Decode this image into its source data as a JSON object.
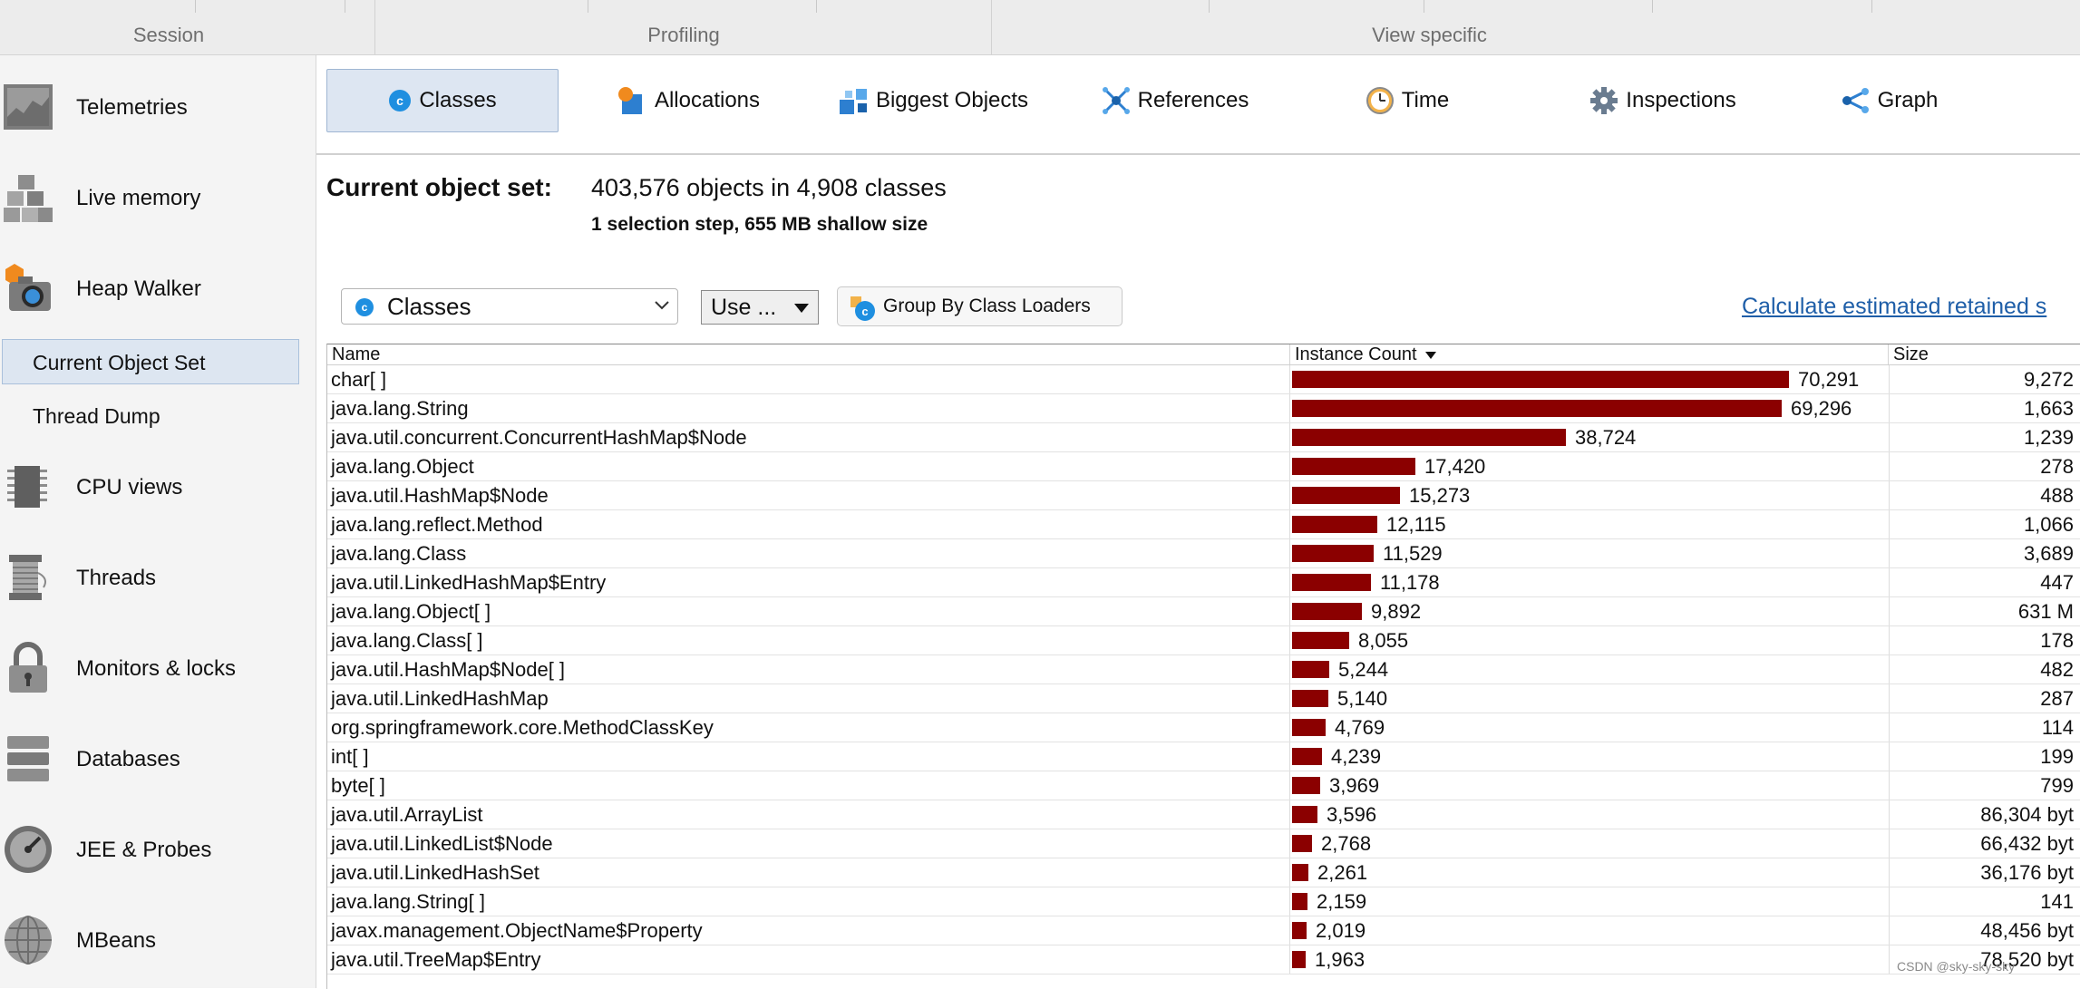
{
  "ribbon": {
    "groups": [
      {
        "label": "Session"
      },
      {
        "label": "Profiling"
      },
      {
        "label": "View specific"
      }
    ]
  },
  "sidebar": {
    "items": [
      {
        "label": "Telemetries",
        "icon": "telemetries-icon"
      },
      {
        "label": "Live memory",
        "icon": "live-memory-icon"
      },
      {
        "label": "Heap Walker",
        "icon": "heap-walker-icon"
      },
      {
        "label": "CPU views",
        "icon": "cpu-views-icon"
      },
      {
        "label": "Threads",
        "icon": "threads-icon"
      },
      {
        "label": "Monitors & locks",
        "icon": "monitors-locks-icon"
      },
      {
        "label": "Databases",
        "icon": "databases-icon"
      },
      {
        "label": "JEE & Probes",
        "icon": "jee-probes-icon"
      },
      {
        "label": "MBeans",
        "icon": "mbeans-icon"
      }
    ],
    "sub_items": [
      {
        "label": "Current Object Set",
        "selected": true
      },
      {
        "label": "Thread Dump",
        "selected": false
      }
    ]
  },
  "tabs": [
    {
      "label": "Classes",
      "icon": "classes-icon",
      "selected": true
    },
    {
      "label": "Allocations",
      "icon": "allocations-icon",
      "selected": false
    },
    {
      "label": "Biggest Objects",
      "icon": "biggest-objects-icon",
      "selected": false
    },
    {
      "label": "References",
      "icon": "references-icon",
      "selected": false
    },
    {
      "label": "Time",
      "icon": "time-icon",
      "selected": false
    },
    {
      "label": "Inspections",
      "icon": "inspections-icon",
      "selected": false
    },
    {
      "label": "Graph",
      "icon": "graph-icon",
      "selected": false
    }
  ],
  "object_set": {
    "title": "Current object set:",
    "summary": "403,576 objects in 4,908 classes",
    "sub": "1 selection step, 655 MB shallow size"
  },
  "toolbar": {
    "view_select": "Classes",
    "use_button": "Use ...",
    "group_button": "Group By Class Loaders",
    "calc_link": "Calculate estimated retained s"
  },
  "table": {
    "columns": {
      "name": "Name",
      "count": "Instance Count",
      "size": "Size"
    },
    "max_count": 70291,
    "bar_color": "#8b0000",
    "rows": [
      {
        "name": "char[ ]",
        "count": "70,291",
        "value": 70291,
        "size": "9,272"
      },
      {
        "name": "java.lang.String",
        "count": "69,296",
        "value": 69296,
        "size": "1,663"
      },
      {
        "name": "java.util.concurrent.ConcurrentHashMap$Node",
        "count": "38,724",
        "value": 38724,
        "size": "1,239"
      },
      {
        "name": "java.lang.Object",
        "count": "17,420",
        "value": 17420,
        "size": "278"
      },
      {
        "name": "java.util.HashMap$Node",
        "count": "15,273",
        "value": 15273,
        "size": "488"
      },
      {
        "name": "java.lang.reflect.Method",
        "count": "12,115",
        "value": 12115,
        "size": "1,066"
      },
      {
        "name": "java.lang.Class",
        "count": "11,529",
        "value": 11529,
        "size": "3,689"
      },
      {
        "name": "java.util.LinkedHashMap$Entry",
        "count": "11,178",
        "value": 11178,
        "size": "447"
      },
      {
        "name": "java.lang.Object[ ]",
        "count": "9,892",
        "value": 9892,
        "size": "631 M"
      },
      {
        "name": "java.lang.Class[ ]",
        "count": "8,055",
        "value": 8055,
        "size": "178"
      },
      {
        "name": "java.util.HashMap$Node[ ]",
        "count": "5,244",
        "value": 5244,
        "size": "482"
      },
      {
        "name": "java.util.LinkedHashMap",
        "count": "5,140",
        "value": 5140,
        "size": "287"
      },
      {
        "name": "org.springframework.core.MethodClassKey",
        "count": "4,769",
        "value": 4769,
        "size": "114"
      },
      {
        "name": "int[ ]",
        "count": "4,239",
        "value": 4239,
        "size": "199"
      },
      {
        "name": "byte[ ]",
        "count": "3,969",
        "value": 3969,
        "size": "799"
      },
      {
        "name": "java.util.ArrayList",
        "count": "3,596",
        "value": 3596,
        "size": "86,304 byt"
      },
      {
        "name": "java.util.LinkedList$Node",
        "count": "2,768",
        "value": 2768,
        "size": "66,432 byt"
      },
      {
        "name": "java.util.LinkedHashSet",
        "count": "2,261",
        "value": 2261,
        "size": "36,176 byt"
      },
      {
        "name": "java.lang.String[ ]",
        "count": "2,159",
        "value": 2159,
        "size": "141"
      },
      {
        "name": "javax.management.ObjectName$Property",
        "count": "2,019",
        "value": 2019,
        "size": "48,456 byt"
      },
      {
        "name": "java.util.TreeMap$Entry",
        "count": "1,963",
        "value": 1963,
        "size": "78,520 byt"
      }
    ]
  },
  "watermark": "CSDN @sky-sky-sky"
}
